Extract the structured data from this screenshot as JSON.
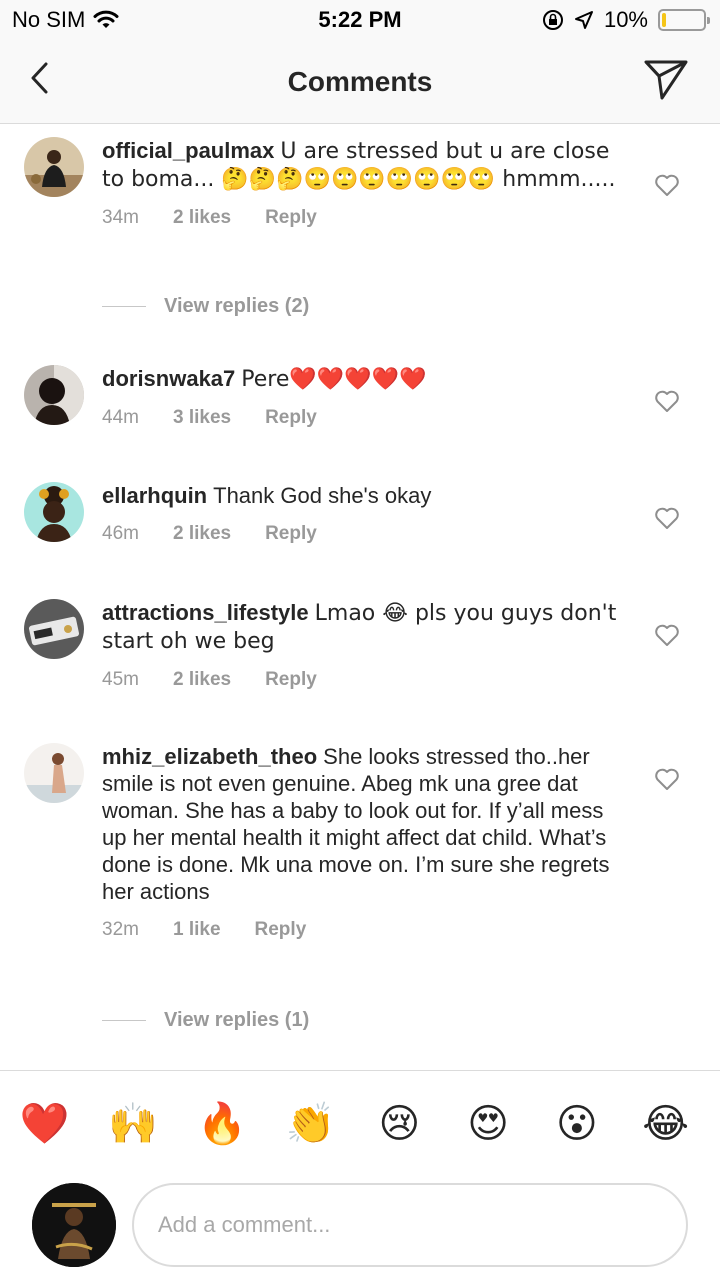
{
  "status_bar": {
    "carrier": "No SIM",
    "time": "5:22 PM",
    "battery_percent": "10%",
    "battery_level": 0.1
  },
  "header": {
    "title": "Comments"
  },
  "comments": [
    {
      "username": "official_paulmax",
      "text": "U are stressed but u are close to boma... 🤔🤔🤔🙄🙄🙄🙄🙄🙄🙄 hmmm.....",
      "time": "34m",
      "likes": "2 likes",
      "reply": "Reply",
      "view_replies": "View replies (2)"
    },
    {
      "username": "dorisnwaka7",
      "text": "Pere❤️❤️❤️❤️❤️",
      "time": "44m",
      "likes": "3 likes",
      "reply": "Reply"
    },
    {
      "username": "ellarhquin",
      "text": "Thank God she's okay",
      "time": "46m",
      "likes": "2 likes",
      "reply": "Reply"
    },
    {
      "username": "attractions_lifestyle",
      "text": "Lmao 😂 pls you guys don't start oh we beg",
      "time": "45m",
      "likes": "2 likes",
      "reply": "Reply"
    },
    {
      "username": "mhiz_elizabeth_theo",
      "text": "She looks stressed tho..her smile is not even genuine. Abeg mk una gree dat woman. She has a baby to look out for. If y’all mess up her mental health it might affect dat child. What’s done is done. Mk una move on. I’m sure she regrets her actions",
      "time": "32m",
      "likes": "1 like",
      "reply": "Reply",
      "view_replies": "View replies (1)"
    }
  ],
  "reactions": [
    "❤️",
    "🙌",
    "🔥",
    "👏",
    "😢",
    "😍",
    "😮",
    "😂"
  ],
  "composer": {
    "placeholder": "Add a comment..."
  },
  "colors": {
    "text": "#262626",
    "secondary": "#999999",
    "border": "#dbdbdb",
    "battery": "#f5c518"
  }
}
